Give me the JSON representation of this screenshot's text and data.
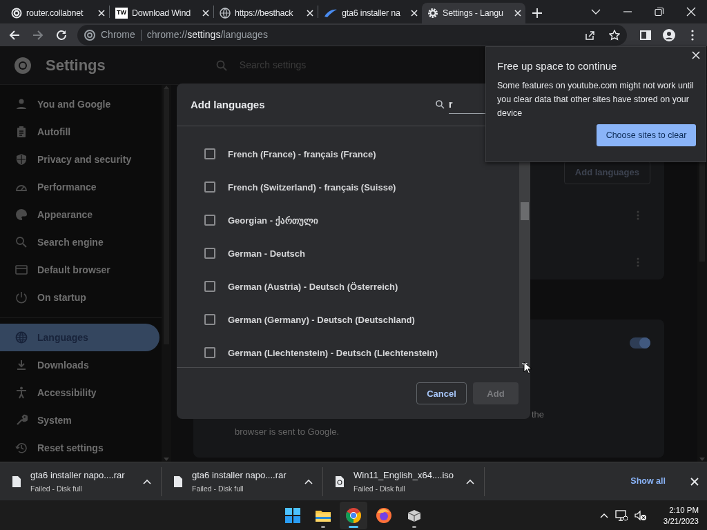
{
  "browser": {
    "tabs": [
      {
        "title": "router.collabnet",
        "selected": false
      },
      {
        "title": "Download Wind",
        "logo_text": "TW",
        "selected": false
      },
      {
        "title": "https://besthack",
        "selected": false
      },
      {
        "title": "gta6 installer na",
        "selected": false
      },
      {
        "title": "Settings - Langu",
        "selected": true
      }
    ],
    "omnibox": {
      "site_label": "Chrome",
      "url_prefix": "chrome://",
      "url_host": "settings",
      "url_path": "/languages"
    }
  },
  "settings": {
    "title": "Settings",
    "search": {
      "placeholder": "Search settings"
    },
    "sidebar": {
      "items": [
        {
          "label": "You and Google",
          "selected": false
        },
        {
          "label": "Autofill",
          "selected": false
        },
        {
          "label": "Privacy and security",
          "selected": false
        },
        {
          "label": "Performance",
          "selected": false
        },
        {
          "label": "Appearance",
          "selected": false
        },
        {
          "label": "Search engine",
          "selected": false
        },
        {
          "label": "Default browser",
          "selected": false
        },
        {
          "label": "On startup",
          "selected": false
        },
        {
          "label": "Languages",
          "selected": true
        },
        {
          "label": "Downloads",
          "selected": false
        },
        {
          "label": "Accessibility",
          "selected": false
        },
        {
          "label": "System",
          "selected": false
        },
        {
          "label": "Reset settings",
          "selected": false
        }
      ]
    }
  },
  "page": {
    "add_languages_button": "Add languages",
    "toggle_on": true,
    "text_line_1": "the",
    "text_line_2": "browser is sent to Google."
  },
  "dialog": {
    "title": "Add languages",
    "search_value": "r",
    "languages": [
      {
        "label": "French (France) - français (France)",
        "checked": false
      },
      {
        "label": "French (Switzerland) - français (Suisse)",
        "checked": false
      },
      {
        "label": "Georgian - ქართული",
        "checked": false
      },
      {
        "label": "German - Deutsch",
        "checked": false
      },
      {
        "label": "German (Austria) - Deutsch (Österreich)",
        "checked": false
      },
      {
        "label": "German (Germany) - Deutsch (Deutschland)",
        "checked": false
      },
      {
        "label": "German (Liechtenstein) - Deutsch (Liechtenstein)",
        "checked": false
      }
    ],
    "cancel_button": "Cancel",
    "add_button": {
      "label": "Add",
      "disabled": true
    }
  },
  "popup": {
    "title": "Free up space to continue",
    "body": "Some features on youtube.com might not work until you clear data that other sites have stored on your device",
    "button": "Choose sites to clear"
  },
  "downloads": {
    "items": [
      {
        "kind": "file",
        "filename": "gta6 installer napo....rar",
        "status": "Failed - Disk full"
      },
      {
        "kind": "file",
        "filename": "gta6 installer napo....rar",
        "status": "Failed - Disk full"
      },
      {
        "kind": "disc",
        "filename": "Win11_English_x64....iso",
        "status": "Failed - Disk full"
      }
    ],
    "show_all": "Show all"
  },
  "taskbar": {
    "apps": [
      {
        "selected": false,
        "running": false
      },
      {
        "selected": false,
        "running": true
      },
      {
        "selected": true,
        "running": true
      },
      {
        "selected": false,
        "running": false
      },
      {
        "selected": false,
        "running": true
      }
    ],
    "time": "2:10 PM",
    "date": "3/21/2023"
  }
}
